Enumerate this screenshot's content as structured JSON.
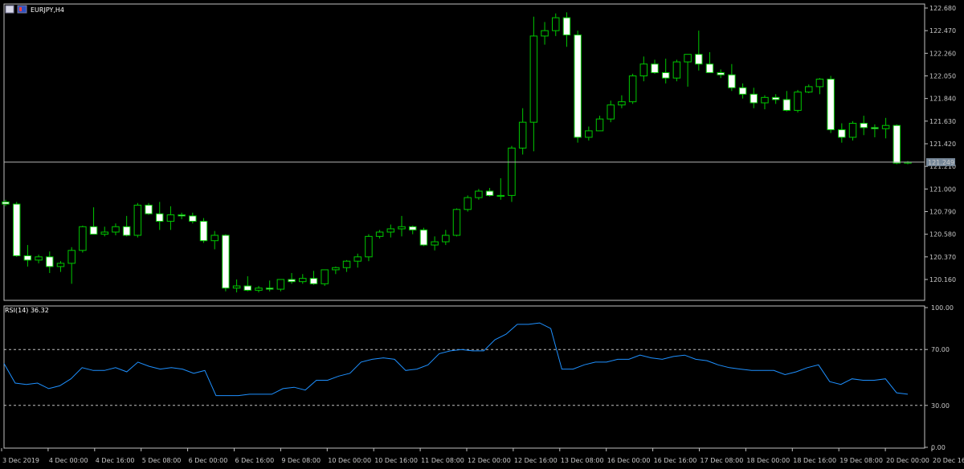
{
  "window": {
    "symbol_title": "EURJPY,H4",
    "icon_names": [
      "window-icon",
      "chart-icon"
    ]
  },
  "colors": {
    "background": "#000000",
    "frame": "#c0c0c0",
    "bull_candle": "#000000",
    "bear_candle": "#ffffff",
    "wick": "#00c800",
    "price_line": "#b4b4b4",
    "price_badge_bg": "#778899",
    "rsi_line": "#1e90ff",
    "level_line": "#c0c0c0",
    "axis_text": "#c8c8c8"
  },
  "chart_data": [
    {
      "type": "candlestick",
      "title": "EURJPY,H4",
      "y_ticks": [
        "122.680",
        "122.470",
        "122.260",
        "122.050",
        "121.840",
        "121.630",
        "121.420",
        "121.210",
        "121.000",
        "120.790",
        "120.580",
        "120.370",
        "120.160"
      ],
      "ylim": [
        120.04,
        122.68
      ],
      "current_price": "121.249",
      "x_labels": [
        "3 Dec 2019",
        "4 Dec 00:00",
        "4 Dec 16:00",
        "5 Dec 08:00",
        "6 Dec 00:00",
        "6 Dec 16:00",
        "9 Dec 08:00",
        "10 Dec 00:00",
        "10 Dec 16:00",
        "11 Dec 08:00",
        "12 Dec 00:00",
        "12 Dec 16:00",
        "13 Dec 08:00",
        "16 Dec 00:00",
        "16 Dec 16:00",
        "17 Dec 08:00",
        "18 Dec 00:00",
        "18 Dec 16:00",
        "19 Dec 08:00",
        "20 Dec 00:00",
        "20 Dec 16:00"
      ],
      "candles": [
        {
          "o": 120.88,
          "h": 120.9,
          "l": 120.84,
          "c": 120.86
        },
        {
          "o": 120.86,
          "h": 120.88,
          "l": 120.37,
          "c": 120.38
        },
        {
          "o": 120.38,
          "h": 120.48,
          "l": 120.28,
          "c": 120.34
        },
        {
          "o": 120.34,
          "h": 120.39,
          "l": 120.31,
          "c": 120.37
        },
        {
          "o": 120.37,
          "h": 120.42,
          "l": 120.22,
          "c": 120.28
        },
        {
          "o": 120.28,
          "h": 120.33,
          "l": 120.23,
          "c": 120.31
        },
        {
          "o": 120.31,
          "h": 120.46,
          "l": 120.12,
          "c": 120.43
        },
        {
          "o": 120.43,
          "h": 120.66,
          "l": 120.41,
          "c": 120.65
        },
        {
          "o": 120.65,
          "h": 120.83,
          "l": 120.58,
          "c": 120.58
        },
        {
          "o": 120.58,
          "h": 120.65,
          "l": 120.56,
          "c": 120.6
        },
        {
          "o": 120.6,
          "h": 120.68,
          "l": 120.57,
          "c": 120.65
        },
        {
          "o": 120.65,
          "h": 120.75,
          "l": 120.56,
          "c": 120.57
        },
        {
          "o": 120.57,
          "h": 120.87,
          "l": 120.55,
          "c": 120.85
        },
        {
          "o": 120.85,
          "h": 120.87,
          "l": 120.76,
          "c": 120.77
        },
        {
          "o": 120.77,
          "h": 120.88,
          "l": 120.62,
          "c": 120.7
        },
        {
          "o": 120.7,
          "h": 120.84,
          "l": 120.62,
          "c": 120.76
        },
        {
          "o": 120.76,
          "h": 120.78,
          "l": 120.72,
          "c": 120.75
        },
        {
          "o": 120.75,
          "h": 120.78,
          "l": 120.68,
          "c": 120.7
        },
        {
          "o": 120.7,
          "h": 120.73,
          "l": 120.5,
          "c": 120.52
        },
        {
          "o": 120.52,
          "h": 120.61,
          "l": 120.44,
          "c": 120.57
        },
        {
          "o": 120.57,
          "h": 120.58,
          "l": 120.05,
          "c": 120.08
        },
        {
          "o": 120.08,
          "h": 120.16,
          "l": 120.04,
          "c": 120.1
        },
        {
          "o": 120.1,
          "h": 120.19,
          "l": 120.05,
          "c": 120.06
        },
        {
          "o": 120.06,
          "h": 120.1,
          "l": 120.04,
          "c": 120.08
        },
        {
          "o": 120.08,
          "h": 120.15,
          "l": 120.05,
          "c": 120.07
        },
        {
          "o": 120.07,
          "h": 120.14,
          "l": 120.05,
          "c": 120.16
        },
        {
          "o": 120.16,
          "h": 120.22,
          "l": 120.12,
          "c": 120.14
        },
        {
          "o": 120.14,
          "h": 120.21,
          "l": 120.12,
          "c": 120.17
        },
        {
          "o": 120.17,
          "h": 120.24,
          "l": 120.11,
          "c": 120.12
        },
        {
          "o": 120.12,
          "h": 120.22,
          "l": 120.1,
          "c": 120.25
        },
        {
          "o": 120.25,
          "h": 120.28,
          "l": 120.21,
          "c": 120.27
        },
        {
          "o": 120.27,
          "h": 120.34,
          "l": 120.23,
          "c": 120.33
        },
        {
          "o": 120.33,
          "h": 120.4,
          "l": 120.27,
          "c": 120.37
        },
        {
          "o": 120.37,
          "h": 120.58,
          "l": 120.33,
          "c": 120.56
        },
        {
          "o": 120.56,
          "h": 120.62,
          "l": 120.54,
          "c": 120.6
        },
        {
          "o": 120.6,
          "h": 120.67,
          "l": 120.55,
          "c": 120.63
        },
        {
          "o": 120.63,
          "h": 120.75,
          "l": 120.56,
          "c": 120.65
        },
        {
          "o": 120.65,
          "h": 120.66,
          "l": 120.58,
          "c": 120.62
        },
        {
          "o": 120.62,
          "h": 120.64,
          "l": 120.47,
          "c": 120.48
        },
        {
          "o": 120.48,
          "h": 120.56,
          "l": 120.43,
          "c": 120.51
        },
        {
          "o": 120.51,
          "h": 120.62,
          "l": 120.48,
          "c": 120.57
        },
        {
          "o": 120.57,
          "h": 120.82,
          "l": 120.56,
          "c": 120.81
        },
        {
          "o": 120.81,
          "h": 120.94,
          "l": 120.79,
          "c": 120.92
        },
        {
          "o": 120.92,
          "h": 121.0,
          "l": 120.9,
          "c": 120.98
        },
        {
          "o": 120.98,
          "h": 121.01,
          "l": 120.93,
          "c": 120.94
        },
        {
          "o": 120.94,
          "h": 121.1,
          "l": 120.9,
          "c": 120.94
        },
        {
          "o": 120.94,
          "h": 121.4,
          "l": 120.88,
          "c": 121.38
        },
        {
          "o": 121.38,
          "h": 121.75,
          "l": 121.32,
          "c": 121.62
        },
        {
          "o": 121.62,
          "h": 122.6,
          "l": 121.35,
          "c": 122.42
        },
        {
          "o": 122.42,
          "h": 122.55,
          "l": 122.34,
          "c": 122.47
        },
        {
          "o": 122.47,
          "h": 122.63,
          "l": 122.42,
          "c": 122.59
        },
        {
          "o": 122.59,
          "h": 122.64,
          "l": 122.32,
          "c": 122.43
        },
        {
          "o": 122.43,
          "h": 122.47,
          "l": 121.43,
          "c": 121.48
        },
        {
          "o": 121.48,
          "h": 121.58,
          "l": 121.45,
          "c": 121.54
        },
        {
          "o": 121.54,
          "h": 121.68,
          "l": 121.57,
          "c": 121.65
        },
        {
          "o": 121.65,
          "h": 121.82,
          "l": 121.62,
          "c": 121.78
        },
        {
          "o": 121.78,
          "h": 121.87,
          "l": 121.75,
          "c": 121.81
        },
        {
          "o": 121.81,
          "h": 122.07,
          "l": 121.79,
          "c": 122.05
        },
        {
          "o": 122.05,
          "h": 122.23,
          "l": 122.0,
          "c": 122.16
        },
        {
          "o": 122.16,
          "h": 122.2,
          "l": 122.07,
          "c": 122.08
        },
        {
          "o": 122.08,
          "h": 122.21,
          "l": 121.98,
          "c": 122.03
        },
        {
          "o": 122.03,
          "h": 122.2,
          "l": 122.0,
          "c": 122.18
        },
        {
          "o": 122.18,
          "h": 122.24,
          "l": 121.95,
          "c": 122.25
        },
        {
          "o": 122.25,
          "h": 122.47,
          "l": 122.1,
          "c": 122.16
        },
        {
          "o": 122.16,
          "h": 122.27,
          "l": 122.08,
          "c": 122.08
        },
        {
          "o": 122.08,
          "h": 122.11,
          "l": 122.03,
          "c": 122.06
        },
        {
          "o": 122.06,
          "h": 122.16,
          "l": 121.91,
          "c": 121.94
        },
        {
          "o": 121.94,
          "h": 121.98,
          "l": 121.84,
          "c": 121.88
        },
        {
          "o": 121.88,
          "h": 121.94,
          "l": 121.75,
          "c": 121.8
        },
        {
          "o": 121.8,
          "h": 121.87,
          "l": 121.74,
          "c": 121.85
        },
        {
          "o": 121.85,
          "h": 121.88,
          "l": 121.79,
          "c": 121.83
        },
        {
          "o": 121.83,
          "h": 121.91,
          "l": 121.72,
          "c": 121.73
        },
        {
          "o": 121.73,
          "h": 121.92,
          "l": 121.71,
          "c": 121.9
        },
        {
          "o": 121.9,
          "h": 121.97,
          "l": 121.89,
          "c": 121.95
        },
        {
          "o": 121.95,
          "h": 122.03,
          "l": 121.88,
          "c": 122.02
        },
        {
          "o": 122.02,
          "h": 122.05,
          "l": 121.52,
          "c": 121.55
        },
        {
          "o": 121.55,
          "h": 121.61,
          "l": 121.43,
          "c": 121.48
        },
        {
          "o": 121.48,
          "h": 121.63,
          "l": 121.45,
          "c": 121.61
        },
        {
          "o": 121.61,
          "h": 121.68,
          "l": 121.5,
          "c": 121.57
        },
        {
          "o": 121.57,
          "h": 121.6,
          "l": 121.48,
          "c": 121.56
        },
        {
          "o": 121.56,
          "h": 121.66,
          "l": 121.47,
          "c": 121.59
        },
        {
          "o": 121.59,
          "h": 121.6,
          "l": 121.23,
          "c": 121.24
        },
        {
          "o": 121.24,
          "h": 121.26,
          "l": 121.23,
          "c": 121.249
        }
      ]
    },
    {
      "type": "line",
      "title": "RSI(14) 36.32",
      "y_ticks": [
        "100.00",
        "70.00",
        "30.00",
        "0.00"
      ],
      "ylim": [
        0,
        100
      ],
      "levels": [
        70,
        30
      ],
      "values": [
        60,
        46,
        45,
        46,
        42,
        44,
        49,
        57,
        55,
        55,
        57,
        54,
        61,
        58,
        56,
        57,
        56,
        53,
        55,
        37,
        37,
        37,
        38,
        38,
        38,
        42,
        43,
        41,
        48,
        48,
        51,
        53,
        61,
        63,
        64,
        63,
        55,
        56,
        59,
        67,
        69,
        70,
        69,
        69,
        77,
        81,
        88,
        88,
        89,
        85,
        56,
        56,
        59,
        61,
        61,
        63,
        63,
        66,
        64,
        63,
        65,
        66,
        63,
        62,
        59,
        57,
        56,
        55,
        55,
        55,
        52,
        54,
        57,
        59,
        47,
        45,
        49,
        48,
        48,
        49,
        39,
        38
      ]
    }
  ]
}
